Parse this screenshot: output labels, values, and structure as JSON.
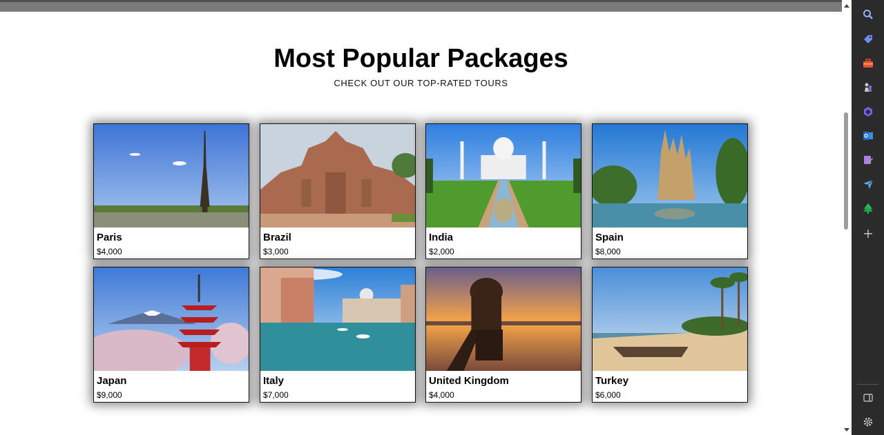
{
  "header": {
    "title": "Most Popular Packages",
    "subtitle": "CHECK OUT OUR TOP-RATED TOURS"
  },
  "packages": [
    {
      "name": "Paris",
      "price": "$4,000",
      "scene": "eiffel-tower"
    },
    {
      "name": "Brazil",
      "price": "$3,000",
      "scene": "stone-temple"
    },
    {
      "name": "India",
      "price": "$2,000",
      "scene": "taj-mahal"
    },
    {
      "name": "Spain",
      "price": "$8,000",
      "scene": "sagrada-familia"
    },
    {
      "name": "Japan",
      "price": "$9,000",
      "scene": "pagoda-fuji"
    },
    {
      "name": "Italy",
      "price": "$7,000",
      "scene": "venice-canal"
    },
    {
      "name": "United Kingdom",
      "price": "$4,000",
      "scene": "sunset-pavilion"
    },
    {
      "name": "Turkey",
      "price": "$6,000",
      "scene": "palm-beach"
    }
  ],
  "sidebar": {
    "icons": [
      "search-icon",
      "tag-icon",
      "toolbox-icon",
      "chess-icon",
      "copilot-icon",
      "outlook-icon",
      "editor-icon",
      "send-icon",
      "tree-icon",
      "add-icon",
      "split-screen-icon",
      "settings-icon"
    ]
  },
  "colors": {
    "topbar": "#7a7a7a",
    "sidebar": "#2b2b2b",
    "card_border": "#111111"
  }
}
